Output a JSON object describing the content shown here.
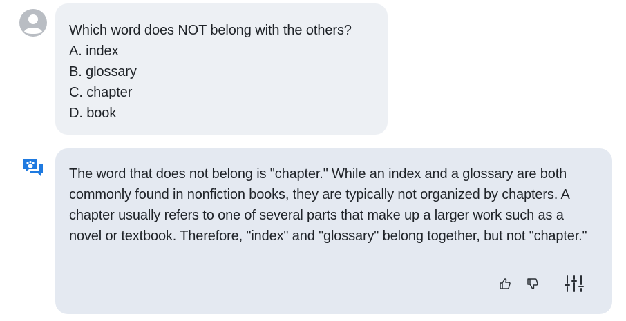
{
  "user_message": {
    "question": "Which word does NOT belong with the others?",
    "options": [
      "A. index",
      "B. glossary",
      "C. chapter",
      "D. book"
    ]
  },
  "bot_message": {
    "text": "The word that does not belong is \"chapter.\" While an index and a glossary are both commonly found in nonfiction books, they are typically not organized by chapters. A chapter usually refers to one of several parts that make up a larger work such as a novel or textbook. Therefore, \"index\" and \"glossary\" belong together, but not \"chapter.\""
  },
  "icons": {
    "user_avatar": "user-avatar-icon",
    "bot_avatar": "bot-chat-paw-icon",
    "like": "thumbs-up-icon",
    "dislike": "thumbs-down-icon",
    "settings": "sliders-icon"
  },
  "colors": {
    "user_bubble": "#edf0f4",
    "bot_bubble": "#e4e9f1",
    "bot_icon": "#1f7ae0",
    "avatar_gray": "#b9bdc3"
  }
}
